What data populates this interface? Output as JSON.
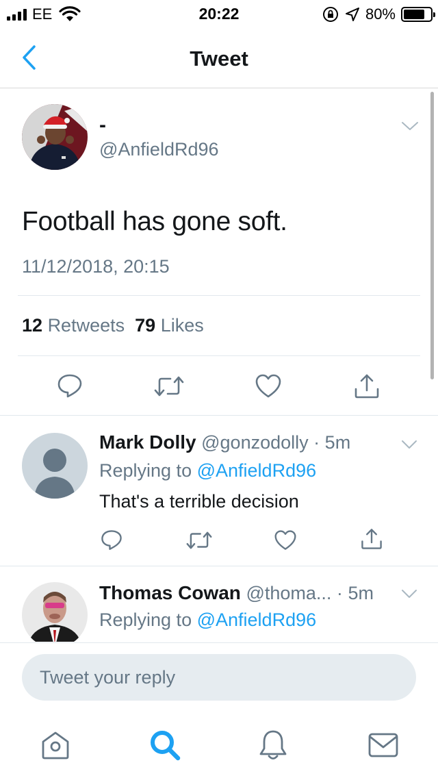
{
  "status_bar": {
    "carrier": "EE",
    "time": "20:22",
    "battery_percent": "80%",
    "battery_level": 0.8
  },
  "nav": {
    "title": "Tweet",
    "back_icon": "chevron-left-icon"
  },
  "tweet": {
    "display_name": "-",
    "handle": "@AnfieldRd96",
    "text": "Football has gone soft.",
    "timestamp": "11/12/2018, 20:15",
    "retweet_count": "12",
    "retweet_label": "Retweets",
    "like_count": "79",
    "like_label": "Likes"
  },
  "replies": [
    {
      "name": "Mark Dolly",
      "handle": "@gonzodolly",
      "separator": "·",
      "time": "5m",
      "replying_label": "Replying to",
      "replying_to": "@AnfieldRd96",
      "text": "That's a terrible decision"
    },
    {
      "name": "Thomas Cowan",
      "handle": "@thoma...",
      "separator": "·",
      "time": "5m",
      "replying_label": "Replying to",
      "replying_to": "@AnfieldRd96"
    }
  ],
  "composer": {
    "placeholder": "Tweet your reply"
  },
  "colors": {
    "accent": "#1da1f2",
    "secondary_text": "#657786",
    "primary_text": "#14171a",
    "divider": "#e1e8ed",
    "input_bg": "#e6ecf0"
  },
  "tab_bar": {
    "active_tab": "search",
    "icons": [
      "home-icon",
      "search-icon",
      "notifications-bell-icon",
      "messages-envelope-icon"
    ]
  }
}
